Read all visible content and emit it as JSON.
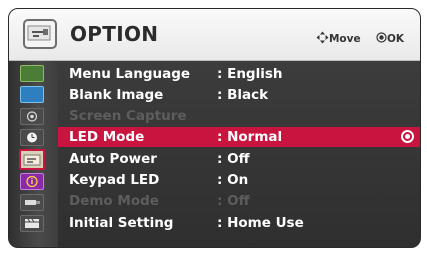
{
  "header": {
    "title": "OPTION",
    "move_hint": "Move",
    "ok_hint": "OK",
    "icon": "option-toolbox-icon"
  },
  "sidebar": {
    "icons": [
      "picture-icon",
      "screen-icon",
      "audio-icon",
      "time-icon",
      "option-icon",
      "info-icon",
      "input-icon",
      "media-icon"
    ],
    "selected_index": 4
  },
  "menu": {
    "rows": [
      {
        "label": "Menu Language",
        "value": ": English",
        "enabled": true
      },
      {
        "label": "Blank Image",
        "value": ": Black",
        "enabled": true
      },
      {
        "label": "Screen Capture",
        "value": "",
        "enabled": false
      },
      {
        "label": "LED Mode",
        "value": ": Normal",
        "enabled": true,
        "selected": true
      },
      {
        "label": "Auto Power",
        "value": ": Off",
        "enabled": true
      },
      {
        "label": "Keypad LED",
        "value": ": On",
        "enabled": true
      },
      {
        "label": "Demo Mode",
        "value": ": Off",
        "enabled": false
      },
      {
        "label": "Initial Setting",
        "value": ": Home Use",
        "enabled": true
      }
    ]
  },
  "colors": {
    "selection": "#c9143f",
    "disabled_text": "#5d5d5d",
    "panel": "#3b3b3b"
  }
}
